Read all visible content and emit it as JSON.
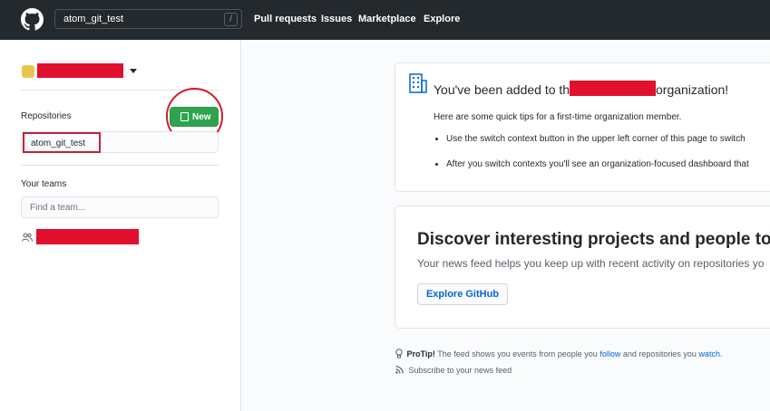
{
  "header": {
    "search_value": "atom_git_test",
    "search_shortcut": "/",
    "nav": [
      "Pull requests",
      "Issues",
      "Marketplace",
      "Explore"
    ]
  },
  "sidebar": {
    "repositories_label": "Repositories",
    "new_button_label": "New",
    "repositories": [
      "atom_git_test"
    ],
    "teams_label": "Your teams",
    "team_search_placeholder": "Find a team..."
  },
  "org_card": {
    "title_prefix": "You've been added to the",
    "title_suffix": "organization!",
    "intro": "Here are some quick tips for a first-time organization member.",
    "tips": [
      "Use the switch context button in the upper left corner of this page to switch",
      "After you switch contexts you'll see an organization-focused dashboard that"
    ]
  },
  "discover": {
    "title": "Discover interesting projects and people to pop",
    "subtitle": "Your news feed helps you keep up with recent activity on repositories yo",
    "button_label": "Explore GitHub"
  },
  "protip": {
    "label": "ProTip!",
    "text_1": "The feed shows you events from people you",
    "link_1": "follow",
    "text_2": "and repositories you",
    "link_2": "watch",
    "text_3": "."
  },
  "subscribe_label": "Subscribe to your news feed",
  "colors": {
    "header_bg": "#24292e",
    "accent_green": "#2ea44f",
    "link_blue": "#0366d6",
    "redaction_red": "#e0102e",
    "annotation_red": "#d7182a"
  }
}
